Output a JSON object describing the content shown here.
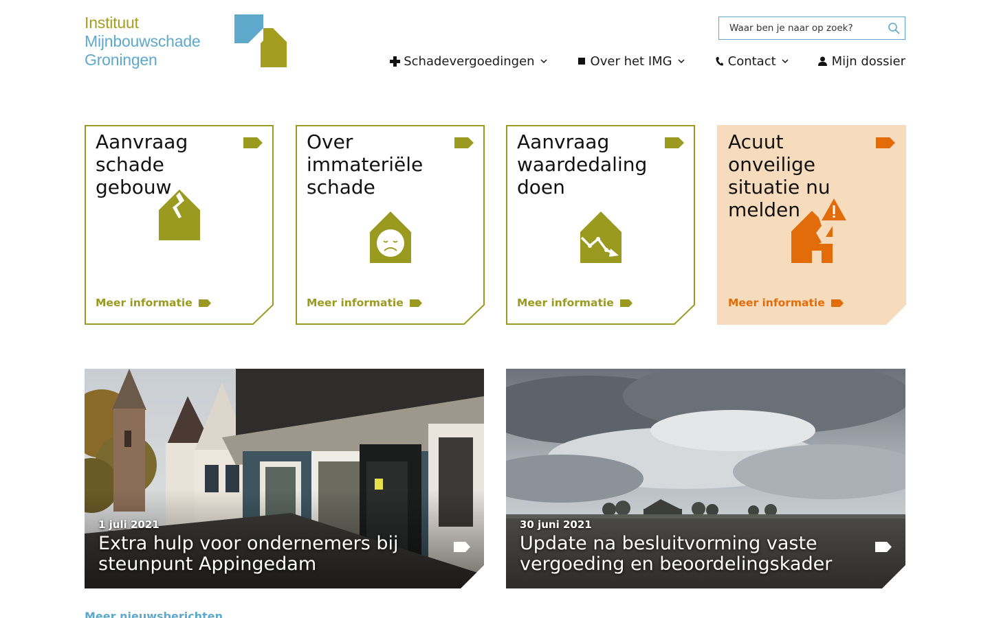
{
  "logo": {
    "line1": "Instituut",
    "line2": "Mijnbouwschade",
    "line3": "Groningen",
    "colors": {
      "olive": "#a39e1f",
      "blue": "#5ea8cc"
    }
  },
  "search": {
    "placeholder": "Waar ben je naar op zoek?",
    "icon": "search-icon"
  },
  "nav": {
    "items": [
      {
        "label": "Schadevergoedingen",
        "icon": "plus-icon",
        "has_dropdown": true
      },
      {
        "label": "Over het IMG",
        "icon": "square-icon",
        "has_dropdown": true
      },
      {
        "label": "Contact",
        "icon": "phone-icon",
        "has_dropdown": true
      },
      {
        "label": "Mijn dossier",
        "icon": "user-icon",
        "has_dropdown": false
      }
    ]
  },
  "tiles": [
    {
      "title": "Aanvraag schade gebouw",
      "link": "Meer informatie",
      "icon": "cracked-house-icon",
      "accent": "#9a9a20"
    },
    {
      "title": "Over immateriële schade",
      "link": "Meer informatie",
      "icon": "sad-face-house-icon",
      "accent": "#9a9a20"
    },
    {
      "title": "Aanvraag waardedaling doen",
      "link": "Meer informatie",
      "icon": "declining-value-house-icon",
      "accent": "#9a9a20"
    },
    {
      "title": "Acuut onveilige situatie nu melden",
      "link": "Meer informatie",
      "icon": "warning-house-icon",
      "accent": "#e36c0a",
      "background": "#f6dcbd"
    }
  ],
  "news": [
    {
      "date": "1 juli 2021",
      "title": "Extra hulp voor ondernemers bij steunpunt Appingedam",
      "image": "street-shops-photo"
    },
    {
      "date": "30 juni 2021",
      "title": "Update na besluitvorming vaste vergoeding en beoordelingskader",
      "image": "farmland-clouds-photo"
    }
  ],
  "more_news": "Meer nieuwsberichten"
}
